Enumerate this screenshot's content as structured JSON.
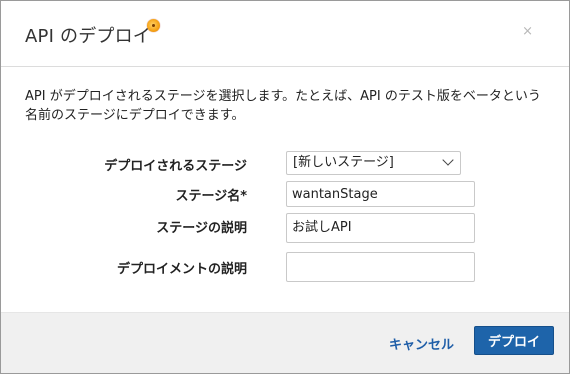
{
  "dialog": {
    "title": "API のデプロイ",
    "close_label": "×"
  },
  "description": "API がデプロイされるステージを選択します。たとえば、API のテスト版をベータという名前のステージにデプロイできます。",
  "form": {
    "stage_label": "デプロイされるステージ",
    "stage_selected": "[新しいステージ]",
    "stage_name_label": "ステージ名*",
    "stage_name_value": "wantanStage",
    "stage_desc_label": "ステージの説明",
    "stage_desc_value": "お試しAPI",
    "deploy_desc_label": "デプロイメントの説明",
    "deploy_desc_value": ""
  },
  "footer": {
    "cancel_label": "キャンセル",
    "deploy_label": "デプロイ"
  },
  "colors": {
    "primary_button": "#1e64aa",
    "link": "#1f5ea8",
    "footer_bg": "#f0f0f0"
  }
}
